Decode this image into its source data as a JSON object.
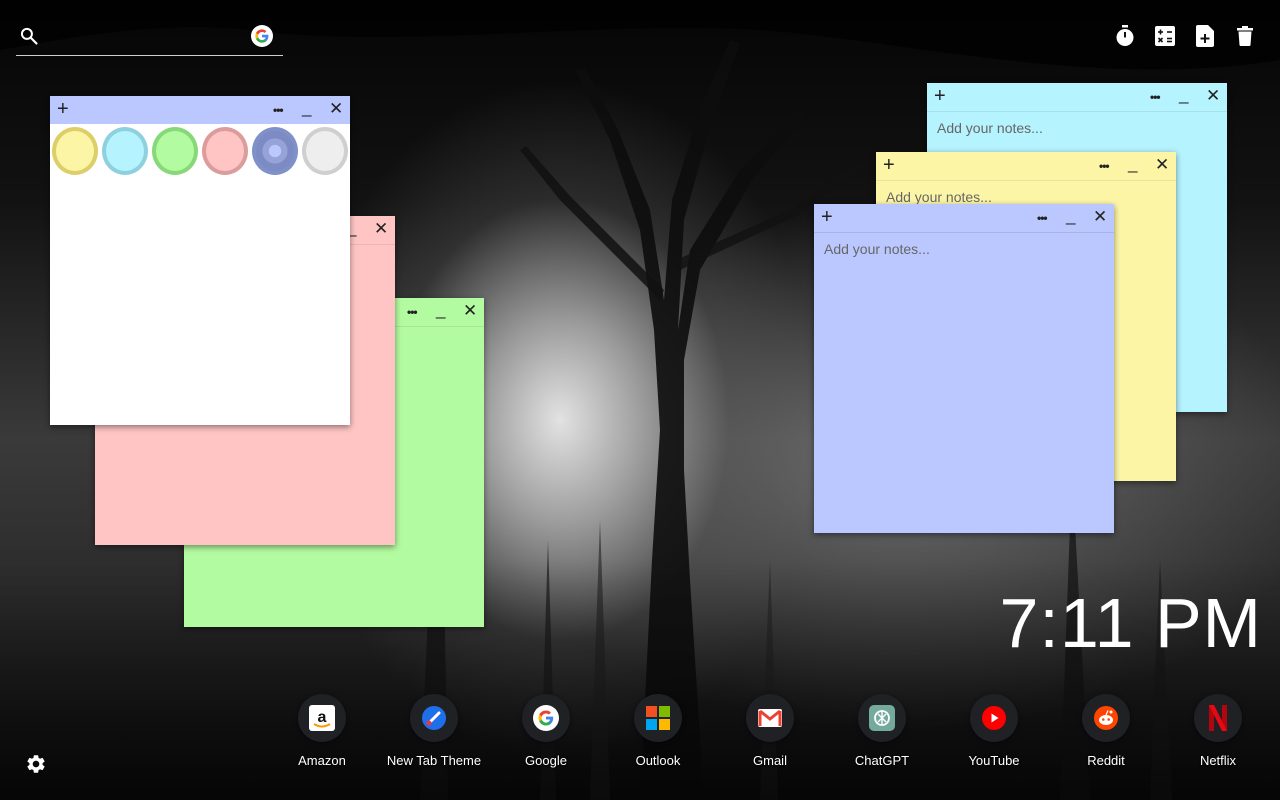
{
  "search": {
    "value": "",
    "placeholder": "",
    "icon": "search-icon",
    "engine_icon": "google-icon"
  },
  "toolbar": {
    "tools": [
      {
        "name": "timer-icon"
      },
      {
        "name": "calculator-icon"
      },
      {
        "name": "new-note-icon"
      },
      {
        "name": "trash-icon"
      }
    ]
  },
  "notes": {
    "plus": "+",
    "more": "•••",
    "minimize": "_",
    "close": "✕",
    "placeholder": "Add your notes...",
    "color_options": [
      "#f8f29f",
      "#a6f0ff",
      "#a6f59b",
      "#ffbebe",
      "#95a3d8",
      "#eeeeee"
    ],
    "note_colors": {
      "white": "#ffffff",
      "pink": "#ffc5c5",
      "green": "#b3fba0",
      "cyan": "#b5f3ff",
      "yellow": "#fdf5a6",
      "blue": "#bbc8ff"
    }
  },
  "clock": {
    "time": "7:11 PM"
  },
  "dock": {
    "apps": [
      {
        "label": "Amazon",
        "icon": "amazon-icon"
      },
      {
        "label": "New Tab Theme",
        "icon": "paint-brush-icon"
      },
      {
        "label": "Google",
        "icon": "google-icon"
      },
      {
        "label": "Outlook",
        "icon": "microsoft-icon"
      },
      {
        "label": "Gmail",
        "icon": "gmail-icon"
      },
      {
        "label": "ChatGPT",
        "icon": "chatgpt-icon"
      },
      {
        "label": "YouTube",
        "icon": "youtube-icon"
      },
      {
        "label": "Reddit",
        "icon": "reddit-icon"
      },
      {
        "label": "Netflix",
        "icon": "netflix-icon"
      }
    ]
  },
  "settings": {
    "icon": "gear-icon"
  }
}
